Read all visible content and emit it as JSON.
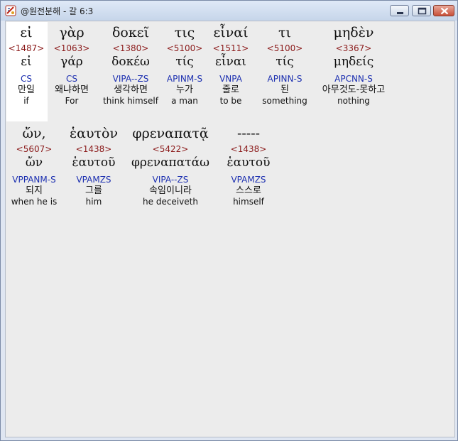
{
  "window": {
    "title": "@원전분해 - 갈 6:3",
    "controls": {
      "minimize": "minimize",
      "maximize": "maximize",
      "close": "close"
    }
  },
  "words": [
    {
      "greek": "εἰ",
      "strong": "<1487>",
      "lemma": "εἰ",
      "parse": "CS",
      "korean": "만일",
      "english": "if"
    },
    {
      "greek": "γὰρ",
      "strong": "<1063>",
      "lemma": "γάρ",
      "parse": "CS",
      "korean": "왜냐하면",
      "english": "For"
    },
    {
      "greek": "δοκεῖ",
      "strong": "<1380>",
      "lemma": "δοκέω",
      "parse": "VIPA--ZS",
      "korean": "생각하면",
      "english": "think himself"
    },
    {
      "greek": "τις",
      "strong": "<5100>",
      "lemma": "τίς",
      "parse": "APINM-S",
      "korean": "누가",
      "english": "a man"
    },
    {
      "greek": "εἶναί",
      "strong": "<1511>",
      "lemma": "εἶναι",
      "parse": "VNPA",
      "korean": "줄로",
      "english": "to be"
    },
    {
      "greek": "τι",
      "strong": "<5100>",
      "lemma": "τίς",
      "parse": "APINN-S",
      "korean": "된",
      "english": "something"
    },
    {
      "greek": "μηδὲν",
      "strong": "<3367>",
      "lemma": "μηδείς",
      "parse": "APCNN-S",
      "korean": "아무것도-못하고",
      "english": "nothing"
    },
    {
      "greek": "ὤν,",
      "strong": "<5607>",
      "lemma": "ὤν",
      "parse": "VPPANM-S",
      "korean": "되지",
      "english": "when he is"
    },
    {
      "greek": "ἑαυτὸν",
      "strong": "<1438>",
      "lemma": "ἑαυτοῦ",
      "parse": "VPAMZS",
      "korean": "그를",
      "english": "him"
    },
    {
      "greek": "φρεναπατᾷ",
      "strong": "<5422>",
      "lemma": "φρεναπατάω",
      "parse": "VIPA--ZS",
      "korean": "속임이니라",
      "english": "he deceiveth"
    },
    {
      "greek": "-----",
      "strong": "<1438>",
      "lemma": "ἑαυτοῦ",
      "parse": "VPAMZS",
      "korean": "스스로",
      "english": "himself"
    }
  ]
}
